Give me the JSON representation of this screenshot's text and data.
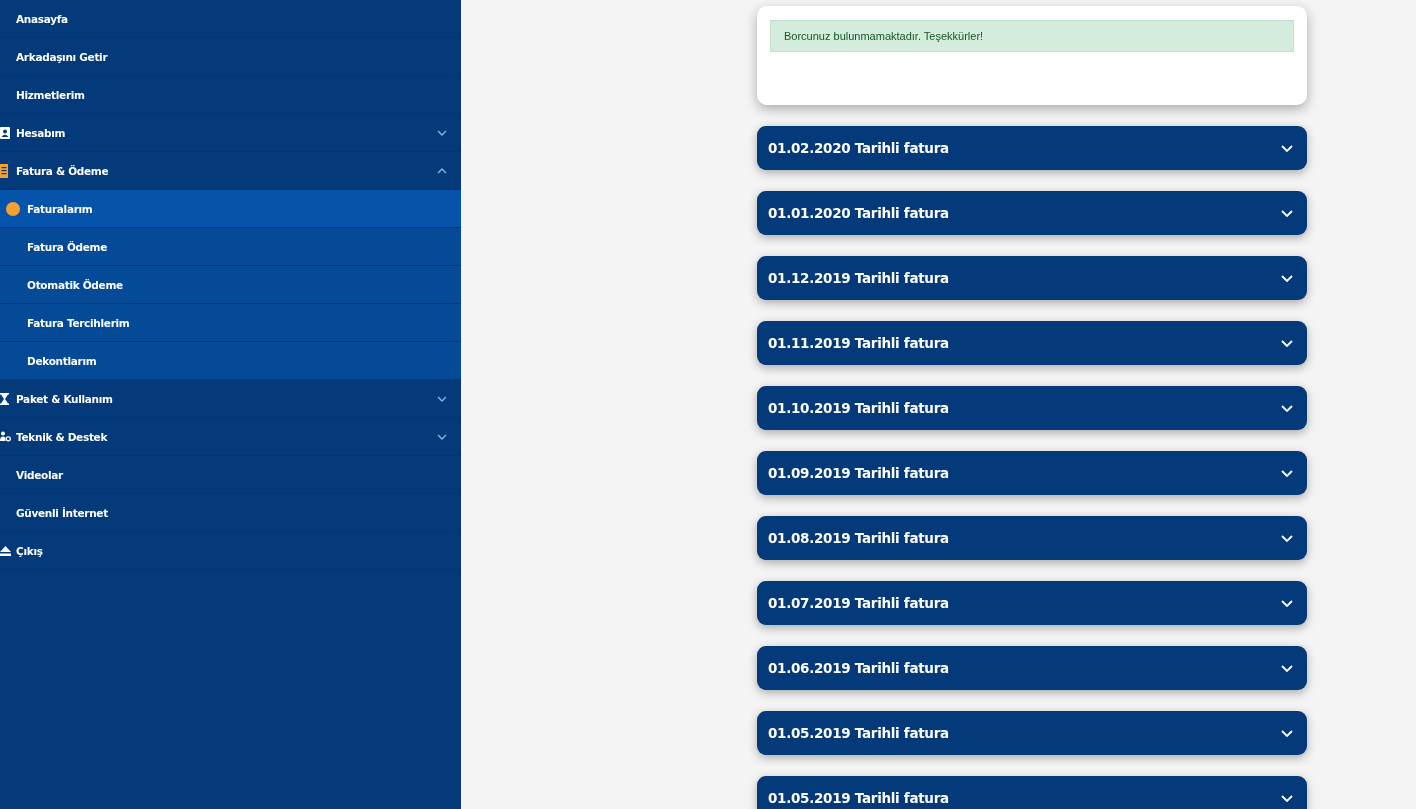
{
  "sidebar": {
    "items": [
      {
        "label": "Anasayfa"
      },
      {
        "label": "Arkadaşını Getir"
      },
      {
        "label": "Hizmetlerim"
      },
      {
        "label": "Hesabım",
        "expanded": false
      },
      {
        "label": "Fatura & Ödeme",
        "expanded": true,
        "children": [
          {
            "label": "Faturalarım",
            "selected": true
          },
          {
            "label": "Fatura Ödeme",
            "selected": false
          },
          {
            "label": "Otomatik Ödeme",
            "selected": false
          },
          {
            "label": "Fatura Tercihlerim",
            "selected": false
          },
          {
            "label": "Dekontlarım",
            "selected": false
          }
        ]
      },
      {
        "label": "Paket & Kullanım",
        "expanded": false
      },
      {
        "label": "Teknik & Destek",
        "expanded": false
      },
      {
        "label": "Videolar"
      },
      {
        "label": "Güvenli İnternet"
      },
      {
        "label": "Çıkış"
      }
    ]
  },
  "alert": {
    "text": "Borcunuz bulunmamaktadır. Teşekkürler!"
  },
  "invoices": [
    {
      "title": "01.02.2020 Tarihli fatura",
      "expanded": false
    },
    {
      "title": "01.01.2020 Tarihli fatura",
      "expanded": false
    },
    {
      "title": "01.12.2019 Tarihli fatura",
      "expanded": false
    },
    {
      "title": "01.11.2019 Tarihli fatura",
      "expanded": false
    },
    {
      "title": "01.10.2019 Tarihli fatura",
      "expanded": false
    },
    {
      "title": "01.09.2019 Tarihli fatura",
      "expanded": false
    },
    {
      "title": "01.08.2019 Tarihli fatura",
      "expanded": false
    },
    {
      "title": "01.07.2019 Tarihli fatura",
      "expanded": false
    },
    {
      "title": "01.06.2019 Tarihli fatura",
      "expanded": false
    },
    {
      "title": "01.05.2019 Tarihli fatura",
      "expanded": false
    },
    {
      "title": "01.05.2019 Tarihli fatura",
      "expanded": false
    }
  ]
}
